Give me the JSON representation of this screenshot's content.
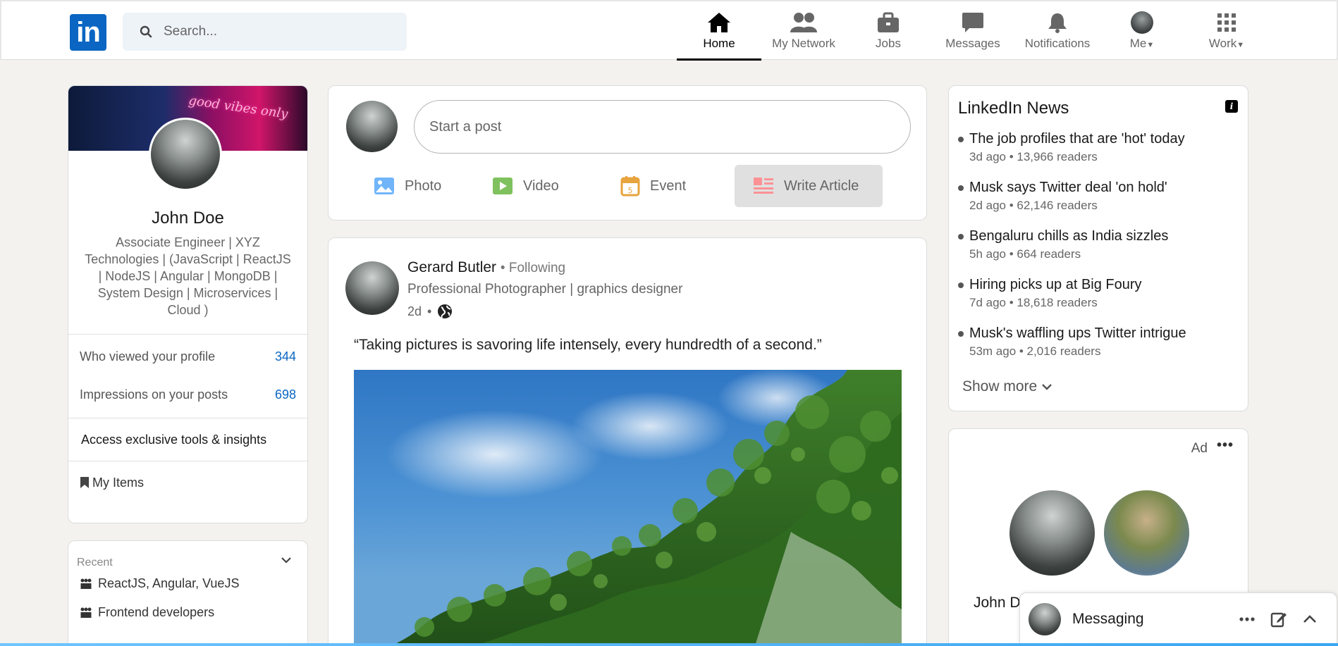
{
  "header": {
    "logo_text": "in",
    "search_placeholder": "Search...",
    "nav": [
      {
        "label": "Home",
        "icon": "home-icon",
        "active": true
      },
      {
        "label": "My Network",
        "icon": "network-icon"
      },
      {
        "label": "Jobs",
        "icon": "briefcase-icon"
      },
      {
        "label": "Messages",
        "icon": "chat-icon"
      },
      {
        "label": "Notifications",
        "icon": "bell-icon"
      },
      {
        "label": "Me",
        "icon": "avatar"
      },
      {
        "label": "Work",
        "icon": "grid-icon"
      }
    ]
  },
  "profile": {
    "banner_text": "good vibes only",
    "name": "John Doe",
    "headline": "Associate Engineer | XYZ Technologies | (JavaScript | ReactJS | NodeJS | Angular | MongoDB | System Design | Microservices | Cloud )",
    "stats": [
      {
        "label": "Who viewed your profile",
        "value": "344"
      },
      {
        "label": "Impressions on your posts",
        "value": "698"
      }
    ],
    "access_text": "Access exclusive tools & insights",
    "my_items": "My Items"
  },
  "recent": {
    "title": "Recent",
    "items": [
      "ReactJS, Angular, VueJS",
      "Frontend developers"
    ]
  },
  "share": {
    "start_post": "Start a post",
    "actions": [
      {
        "label": "Photo",
        "color": "#70b5f9"
      },
      {
        "label": "Video",
        "color": "#7fc15e"
      },
      {
        "label": "Event",
        "color": "#e7a33e"
      },
      {
        "label": "Write Article",
        "color": "#fc9295"
      }
    ]
  },
  "post": {
    "author": "Gerard Butler",
    "following": "• Following",
    "subtitle": "Professional Photographer | graphics designer",
    "time": "2d",
    "separator": "•",
    "text": "“Taking pictures is savoring life intensely, every hundredth of a second.”"
  },
  "news": {
    "title": "LinkedIn News",
    "items": [
      {
        "headline": "The job profiles that are 'hot' today",
        "meta": "3d ago • 13,966 readers"
      },
      {
        "headline": "Musk says Twitter deal 'on hold'",
        "meta": "2d ago • 62,146 readers"
      },
      {
        "headline": "Bengaluru chills as India sizzles",
        "meta": "5h ago • 664 readers"
      },
      {
        "headline": "Hiring picks up at Big Foury",
        "meta": "7d ago • 18,618 readers"
      },
      {
        "headline": "Musk's waffling ups Twitter intrigue",
        "meta": "53m ago • 2,016 readers"
      }
    ],
    "show_more": "Show more"
  },
  "ad": {
    "label": "Ad",
    "more": "•••",
    "name": "John D"
  },
  "messaging": {
    "label": "Messaging"
  },
  "colors": {
    "brand": "#0a66c2",
    "background": "#f3f2ef"
  }
}
